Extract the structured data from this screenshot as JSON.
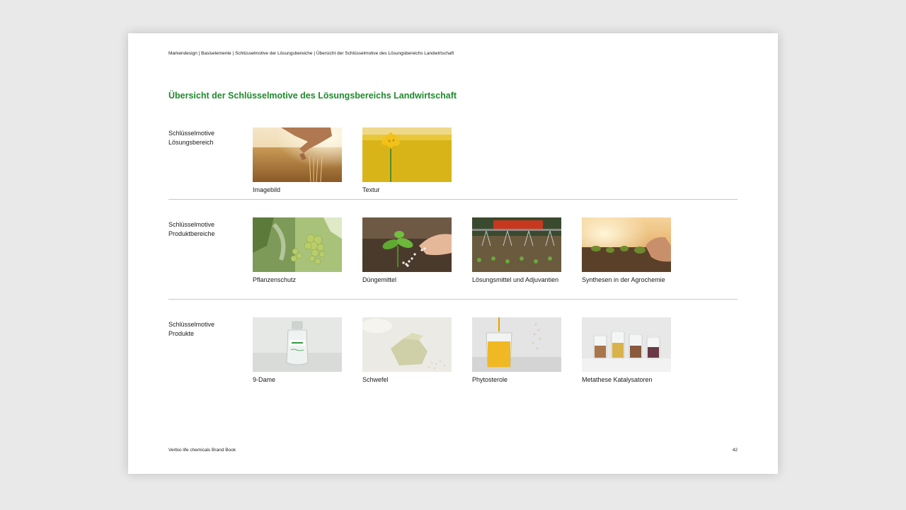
{
  "breadcrumb": "Markendesign | Basiselemente  | Schlüsselmotive der Lösungsbereiche | Übersicht der Schlüsselmotive des Lösungsbereichs Landwirtschaft",
  "title": "Übersicht der Schlüsselmotive des Lösungsbereichs Landwirtschaft",
  "sections": [
    {
      "label_line1": "Schlüsselmotive",
      "label_line2": "Lösungsbereich",
      "items": [
        {
          "caption": "Imagebild",
          "motif": "hand-wheat-field"
        },
        {
          "caption": "Textur",
          "motif": "rapeseed-flower"
        }
      ]
    },
    {
      "label_line1": "Schlüsselmotive",
      "label_line2": "Produktbereiche",
      "items": [
        {
          "caption": "Pflanzenschutz",
          "motif": "grapes-spray"
        },
        {
          "caption": "Düngemittel",
          "motif": "seedling-fertilizer"
        },
        {
          "caption": "Lösungsmittel und Adjuvantien",
          "motif": "tractor-sprayer"
        },
        {
          "caption": "Synthesen in der Agrochemie",
          "motif": "hand-seedling-sunset"
        }
      ]
    },
    {
      "label_line1": "Schlüsselmotive",
      "label_line2": "Produkte",
      "items": [
        {
          "caption": "9-Dame",
          "motif": "glass-bottle"
        },
        {
          "caption": "Schwefel",
          "motif": "sulfur-rock"
        },
        {
          "caption": "Phytosterole",
          "motif": "beaker-oil"
        },
        {
          "caption": "Metathese Katalysatoren",
          "motif": "sample-jars"
        }
      ]
    }
  ],
  "footer": {
    "left": "Verbio life chemicals Brand Book",
    "page_number": "42"
  },
  "colors": {
    "title_green": "#1f8a2c",
    "page_background": "#ffffff",
    "surround": "#e9e9e9",
    "divider": "#c8c8c8"
  }
}
